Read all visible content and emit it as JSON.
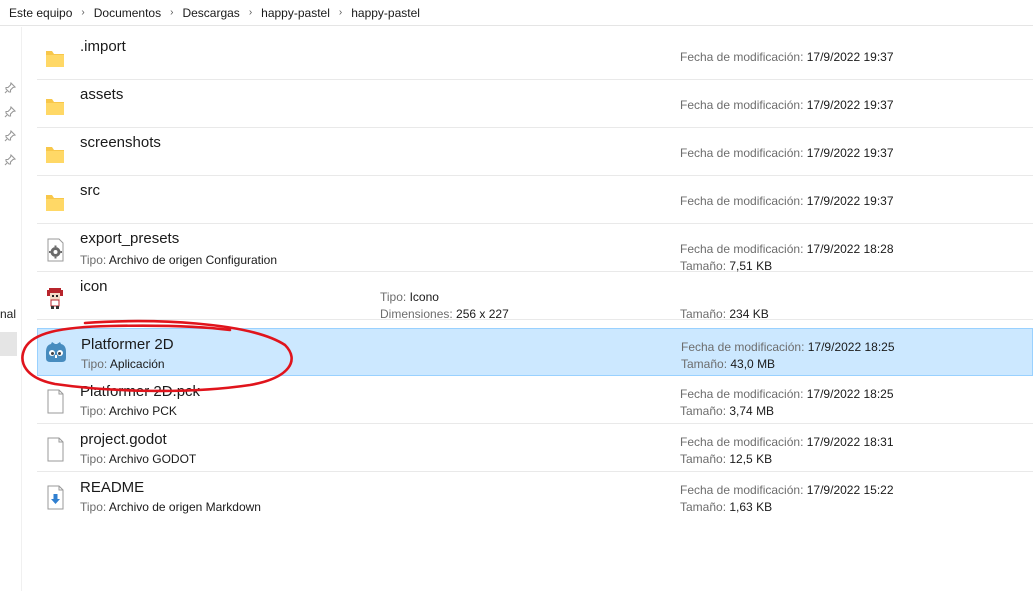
{
  "breadcrumb": [
    "Este equipo",
    "Documentos",
    "Descargas",
    "happy-pastel",
    "happy-pastel"
  ],
  "left_pane": {
    "partial_label": "nal"
  },
  "labels": {
    "modified": "Fecha de modificación:",
    "type": "Tipo:",
    "size": "Tamaño:",
    "dimensions": "Dimensiones:"
  },
  "files": [
    {
      "name": ".import",
      "icon": "folder-icon",
      "modified": "17/9/2022 19:37"
    },
    {
      "name": "assets",
      "icon": "folder-icon",
      "modified": "17/9/2022 19:37"
    },
    {
      "name": "screenshots",
      "icon": "folder-icon",
      "modified": "17/9/2022 19:37"
    },
    {
      "name": "src",
      "icon": "folder-icon",
      "modified": "17/9/2022 19:37"
    },
    {
      "name": "export_presets",
      "icon": "config-gear-icon",
      "type": "Archivo de origen Configuration",
      "modified": "17/9/2022 18:28",
      "size": "7,51 KB"
    },
    {
      "name": "icon",
      "icon": "character-image-icon",
      "type": "Icono",
      "dimensions": "256 x 227",
      "size": "234 KB"
    },
    {
      "name": "Platformer 2D",
      "icon": "godot-icon",
      "type": "Aplicación",
      "modified": "17/9/2022 18:25",
      "size": "43,0 MB",
      "selected": true
    },
    {
      "name": "Platformer 2D.pck",
      "icon": "blank-file-icon",
      "type": "Archivo PCK",
      "modified": "17/9/2022 18:25",
      "size": "3,74 MB"
    },
    {
      "name": "project.godot",
      "icon": "blank-file-icon",
      "type": "Archivo GODOT",
      "modified": "17/9/2022 18:31",
      "size": "12,5 KB"
    },
    {
      "name": "README",
      "icon": "markdown-file-icon",
      "type": "Archivo de origen Markdown",
      "modified": "17/9/2022 15:22",
      "size": "1,63 KB"
    }
  ],
  "colors": {
    "selection": "#cce8ff",
    "selection_border": "#99d1ff",
    "annotation": "#e0141c",
    "folder": "#f8c74a"
  }
}
